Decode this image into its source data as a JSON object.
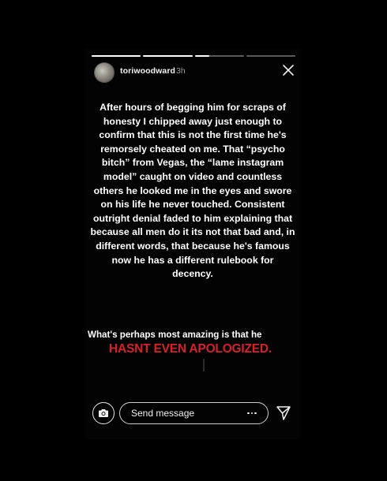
{
  "header": {
    "username": "toriwoodward",
    "timestamp": "3h",
    "close_icon": "close-icon"
  },
  "progress": {
    "segments": [
      1,
      1,
      0.3,
      0
    ],
    "fill_color": "#ffffff",
    "track_color": "#5a5a5a"
  },
  "story": {
    "paragraph": "After hours of begging him for scraps of honesty I chipped away just enough to confirm that this is not the first time he's remorsely cheated on me. That “psycho bitch” from Vegas, the “lame instagram model” caught on video and countless others he looked me in the eyes and swore on his life he never touched. Consistent outright denial faded to him explaining that because all men do it its not that bad and, in different words, that because he's famous now he has a different rulebook for decency.",
    "second_line": "What's perhaps most amazing is that he",
    "headline": "HASNT EVEN APOLOGIZED.",
    "headline_color": "#d9212a"
  },
  "footer": {
    "camera_icon": "camera-icon",
    "message_placeholder": "Send message",
    "more_icon": "more-options-icon",
    "send_icon": "send-icon"
  }
}
